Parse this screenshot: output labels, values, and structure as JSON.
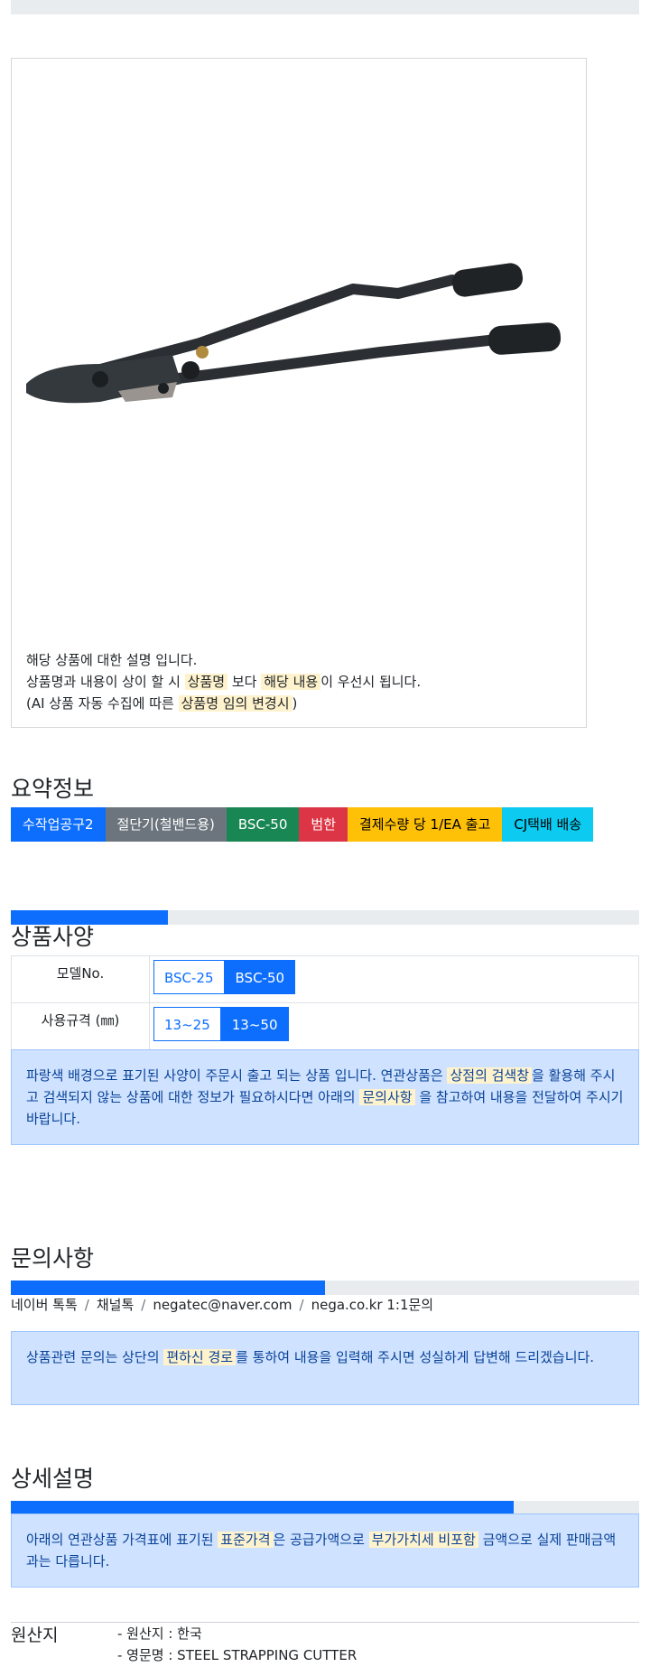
{
  "product": {
    "image_alt": "STEEL STRAPPING CUTTER",
    "desc_line1": "해당 상품에 대한 설명 입니다.",
    "desc_line2_a": "상품명과 내용이 상이 할 시",
    "desc_line2_hl1": "상품명",
    "desc_line2_b": "보다",
    "desc_line2_hl2": "해당 내용",
    "desc_line2_c": "이 우선시 됩니다.",
    "desc_line3_a": "(AI 상품 자동 수집에 따른",
    "desc_line3_hl": "상품명 임의 변경시",
    "desc_line3_b": ")"
  },
  "summary": {
    "title": "요약정보",
    "badges": [
      {
        "label": "수작업공구2",
        "color": "#0d6efd"
      },
      {
        "label": "절단기(철밴드용)",
        "color": "#6c757d"
      },
      {
        "label": "BSC-50",
        "color": "#198754"
      },
      {
        "label": "범한",
        "color": "#dc3545"
      },
      {
        "label": "결제수량 당 1/EA 출고",
        "color": "#ffc107"
      },
      {
        "label": "CJ택배 배송",
        "color": "#0dcaf0"
      }
    ]
  },
  "spec": {
    "title": "상품사양",
    "progress": 0.25,
    "rows": [
      {
        "label": "모델No.",
        "options": [
          "BSC-25",
          "BSC-50"
        ],
        "selected": "BSC-50"
      },
      {
        "label": "사용규격 (㎜)",
        "options": [
          "13~25",
          "13~50"
        ],
        "selected": "13~50"
      }
    ],
    "notice_a": "파랑색 배경으로 표기된 사양이 주문시 출고 되는 상품 입니다. 연관상품은",
    "notice_hl1": "상점의 검색창",
    "notice_b": "을 활용해 주시고 검색되지 않는 상품에 대한 정보가 필요하시다면 아래의",
    "notice_hl2": "문의사항",
    "notice_c": "을 참고하여 내용을 전달하여 주시기 바랍니다."
  },
  "inquiry": {
    "title": "문의사항",
    "progress": 0.5,
    "channels": [
      "네이버 톡톡",
      "채널톡",
      "negatec@naver.com",
      "nega.co.kr 1:1문의"
    ],
    "notice_a": "상품관련 문의는 상단의",
    "notice_hl": "편하신 경로",
    "notice_b": "를 통하여 내용을 입력해 주시면 성실하게 답변해 드리겠습니다."
  },
  "detail": {
    "title": "상세설명",
    "progress": 0.8,
    "notice_a": "아래의 연관상품 가격표에 표기된",
    "notice_hl1": "표준가격",
    "notice_b": "은 공급가액으로",
    "notice_hl2": "부가가치세 비포함",
    "notice_c": "금액으로 실제 판매금액과는 다릅니다."
  },
  "origin": {
    "label": "원산지",
    "items": [
      "- 원산지 : 한국",
      "- 영문명 : STEEL STRAPPING CUTTER"
    ]
  }
}
